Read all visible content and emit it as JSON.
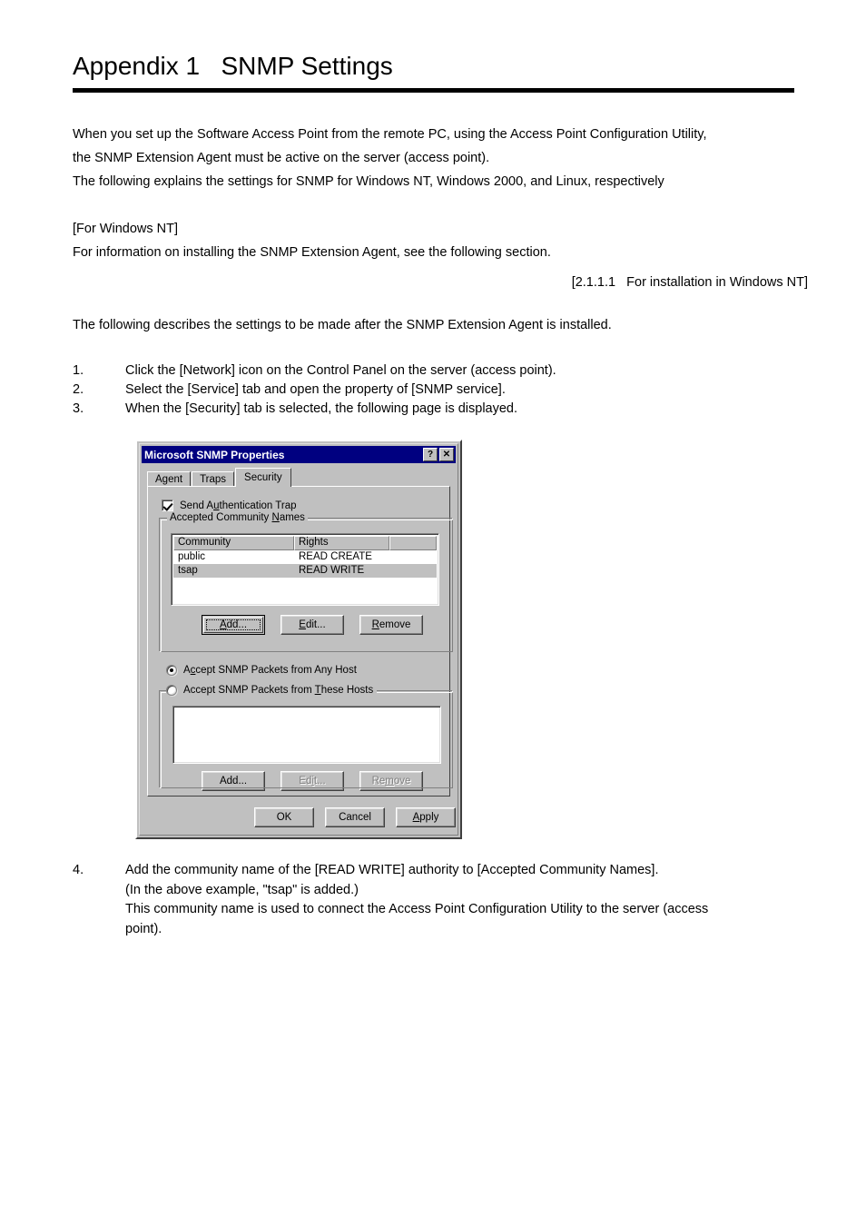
{
  "document": {
    "title": "Appendix 1   SNMP Settings",
    "intro": "When you set up the Software Access Point from the remote PC, using the Access Point Configuration Utility,\nthe SNMP Extension Agent must be active on the server (access point).\nThe following explains the settings for SNMP for Windows NT, Windows 2000, and Linux, respectively",
    "win_nt_section": "[For Windows NT]\nFor information on installing the SNMP Extension Agent, see the following section.",
    "cross_reference": "[2.1.1.1   For installation in Windows NT]",
    "describes": "The following describes the settings to be made after the SNMP Extension Agent is installed.",
    "steps": [
      {
        "num": "1.",
        "text": "Click the [Network] icon on the Control Panel on the server (access point)."
      },
      {
        "num": "2.",
        "text": "Select the [Service] tab and open the property of [SNMP service]."
      },
      {
        "num": "3.",
        "text": "When the [Security] tab is selected, the following page is displayed."
      }
    ],
    "steps_after": [
      {
        "num": "4.",
        "text": "Add the community name of the [READ WRITE] authority to [Accepted Community Names].\n(In the above example, \"tsap\" is added.)\nThis community name is used to connect the Access Point Configuration Utility to the server (access\npoint)."
      }
    ]
  },
  "dialog": {
    "title": "Microsoft SNMP Properties",
    "titlebar_color": "#000080",
    "face_color": "#c0c0c0",
    "help_button": "?",
    "close_button": "✕",
    "tabs": [
      {
        "label": "Agent",
        "active": false
      },
      {
        "label": "Traps",
        "active": false
      },
      {
        "label": "Security",
        "active": true
      }
    ],
    "send_auth_trap": {
      "label_pre": "Send A",
      "label_accel": "u",
      "label_post": "thentication Trap",
      "checked": true
    },
    "community_group": {
      "title_pre": "Accepted Community ",
      "title_accel": "N",
      "title_post": "ames",
      "columns": [
        "Community",
        "Rights",
        ""
      ],
      "rows": [
        {
          "community": "public",
          "rights": "READ CREATE",
          "selected": false
        },
        {
          "community": "tsap",
          "rights": "READ WRITE",
          "selected": true
        }
      ],
      "buttons": [
        {
          "label_pre": "",
          "label_accel": "A",
          "label_post": "dd...",
          "state": "focused"
        },
        {
          "label_pre": "",
          "label_accel": "E",
          "label_post": "dit...",
          "state": "normal"
        },
        {
          "label_pre": "",
          "label_accel": "R",
          "label_post": "emove",
          "state": "normal"
        }
      ]
    },
    "radio_any_host": {
      "label_pre": "A",
      "label_accel": "c",
      "label_post": "cept SNMP Packets from Any Host",
      "selected": true
    },
    "radio_these_hosts": {
      "label_pre": "Accept SNMP Packets from ",
      "label_accel": "T",
      "label_post": "hese Hosts",
      "selected": false
    },
    "hosts_list": {
      "items": []
    },
    "hosts_buttons": [
      {
        "label_pre": "Add",
        "label_accel": "",
        "label_post": "...",
        "state": "normal"
      },
      {
        "label_pre": "Ed",
        "label_accel": "i",
        "label_post": "t...",
        "state": "disabled"
      },
      {
        "label_pre": "Re",
        "label_accel": "m",
        "label_post": "ove",
        "state": "disabled"
      }
    ],
    "bottom_buttons": [
      {
        "label_pre": "OK",
        "label_accel": "",
        "label_post": "",
        "state": "normal"
      },
      {
        "label_pre": "Cancel",
        "label_accel": "",
        "label_post": "",
        "state": "normal"
      },
      {
        "label_pre": "",
        "label_accel": "A",
        "label_post": "pply",
        "state": "normal"
      }
    ]
  }
}
